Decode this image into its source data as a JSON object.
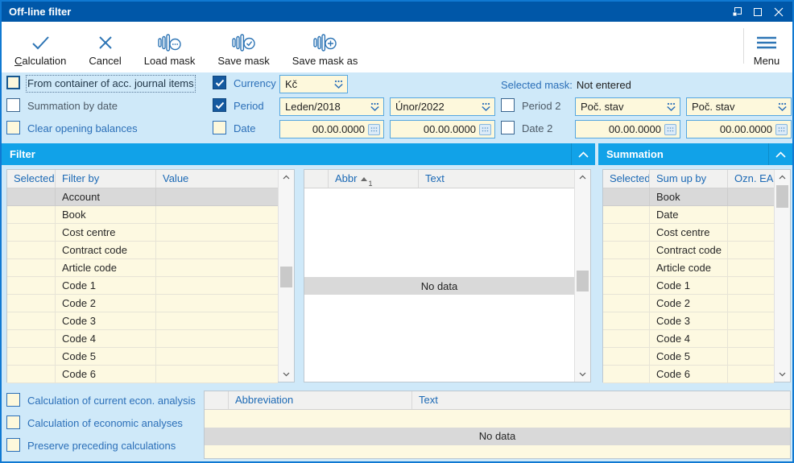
{
  "window": {
    "title": "Off-line filter"
  },
  "toolbar": {
    "buttons": [
      {
        "label": "Calculation"
      },
      {
        "label": "Cancel"
      },
      {
        "label": "Load mask"
      },
      {
        "label": "Save mask"
      },
      {
        "label": "Save mask as"
      }
    ],
    "menu_label": "Menu"
  },
  "options": {
    "from_container": {
      "label": "From container of acc. journal items",
      "checked": false
    },
    "summation_by_date": {
      "label": "Summation by date",
      "checked": false
    },
    "clear_opening_balances": {
      "label": "Clear opening balances",
      "checked": false
    },
    "currency": {
      "label": "Currency",
      "checked": true,
      "value": "Kč"
    },
    "period": {
      "label": "Period",
      "checked": true,
      "from": "Leden/2018",
      "to": "Únor/2022"
    },
    "period2": {
      "label": "Period 2",
      "checked": false,
      "from": "Poč. stav",
      "to": "Poč. stav"
    },
    "date": {
      "label": "Date",
      "checked": false,
      "from": "00.00.0000",
      "to": "00.00.0000"
    },
    "date2": {
      "label": "Date 2",
      "checked": false,
      "from": "00.00.0000",
      "to": "00.00.0000"
    },
    "selected_mask_label": "Selected mask:",
    "selected_mask_value": "Not entered"
  },
  "filter_panel": {
    "title": "Filter",
    "table": {
      "columns": {
        "c1": "Selected",
        "c2": "Filter by",
        "c3": "Value"
      },
      "rows": [
        "Account",
        "Book",
        "Cost centre",
        "Contract code",
        "Article code",
        "Code 1",
        "Code 2",
        "Code 3",
        "Code 4",
        "Code 5",
        "Code 6"
      ],
      "selected_row": "Account"
    },
    "values_table": {
      "columns": {
        "c2": "Abbr",
        "c3": "Text"
      },
      "sort": {
        "column": "Abbr",
        "direction": "asc",
        "order": "1"
      },
      "empty_text": "No data"
    }
  },
  "summation_panel": {
    "title": "Summation",
    "table": {
      "columns": {
        "c1": "Selected",
        "c2": "Sum up by",
        "c3": "Ozn. EA"
      },
      "rows": [
        "Book",
        "Date",
        "Cost centre",
        "Contract code",
        "Article code",
        "Code 1",
        "Code 2",
        "Code 3",
        "Code 4",
        "Code 5",
        "Code 6"
      ],
      "selected_row": "Book"
    }
  },
  "bottom": {
    "checkboxes": [
      {
        "label": "Calculation of current econ. analysis",
        "checked": false
      },
      {
        "label": "Calculation of economic analyses",
        "checked": false
      },
      {
        "label": "Preserve preceding calculations",
        "checked": false
      }
    ],
    "table": {
      "columns": {
        "c2": "Abbreviation",
        "c3": "Text"
      },
      "empty_text": "No data"
    }
  },
  "colors": {
    "titlebar": "#0057a8",
    "panel_header": "#11a2e8",
    "window_background": "#cfe9f9",
    "field_yellow": "#fdf8dc",
    "accent_blue": "#2b6fb8",
    "selected_row": "#d9d9d9"
  }
}
